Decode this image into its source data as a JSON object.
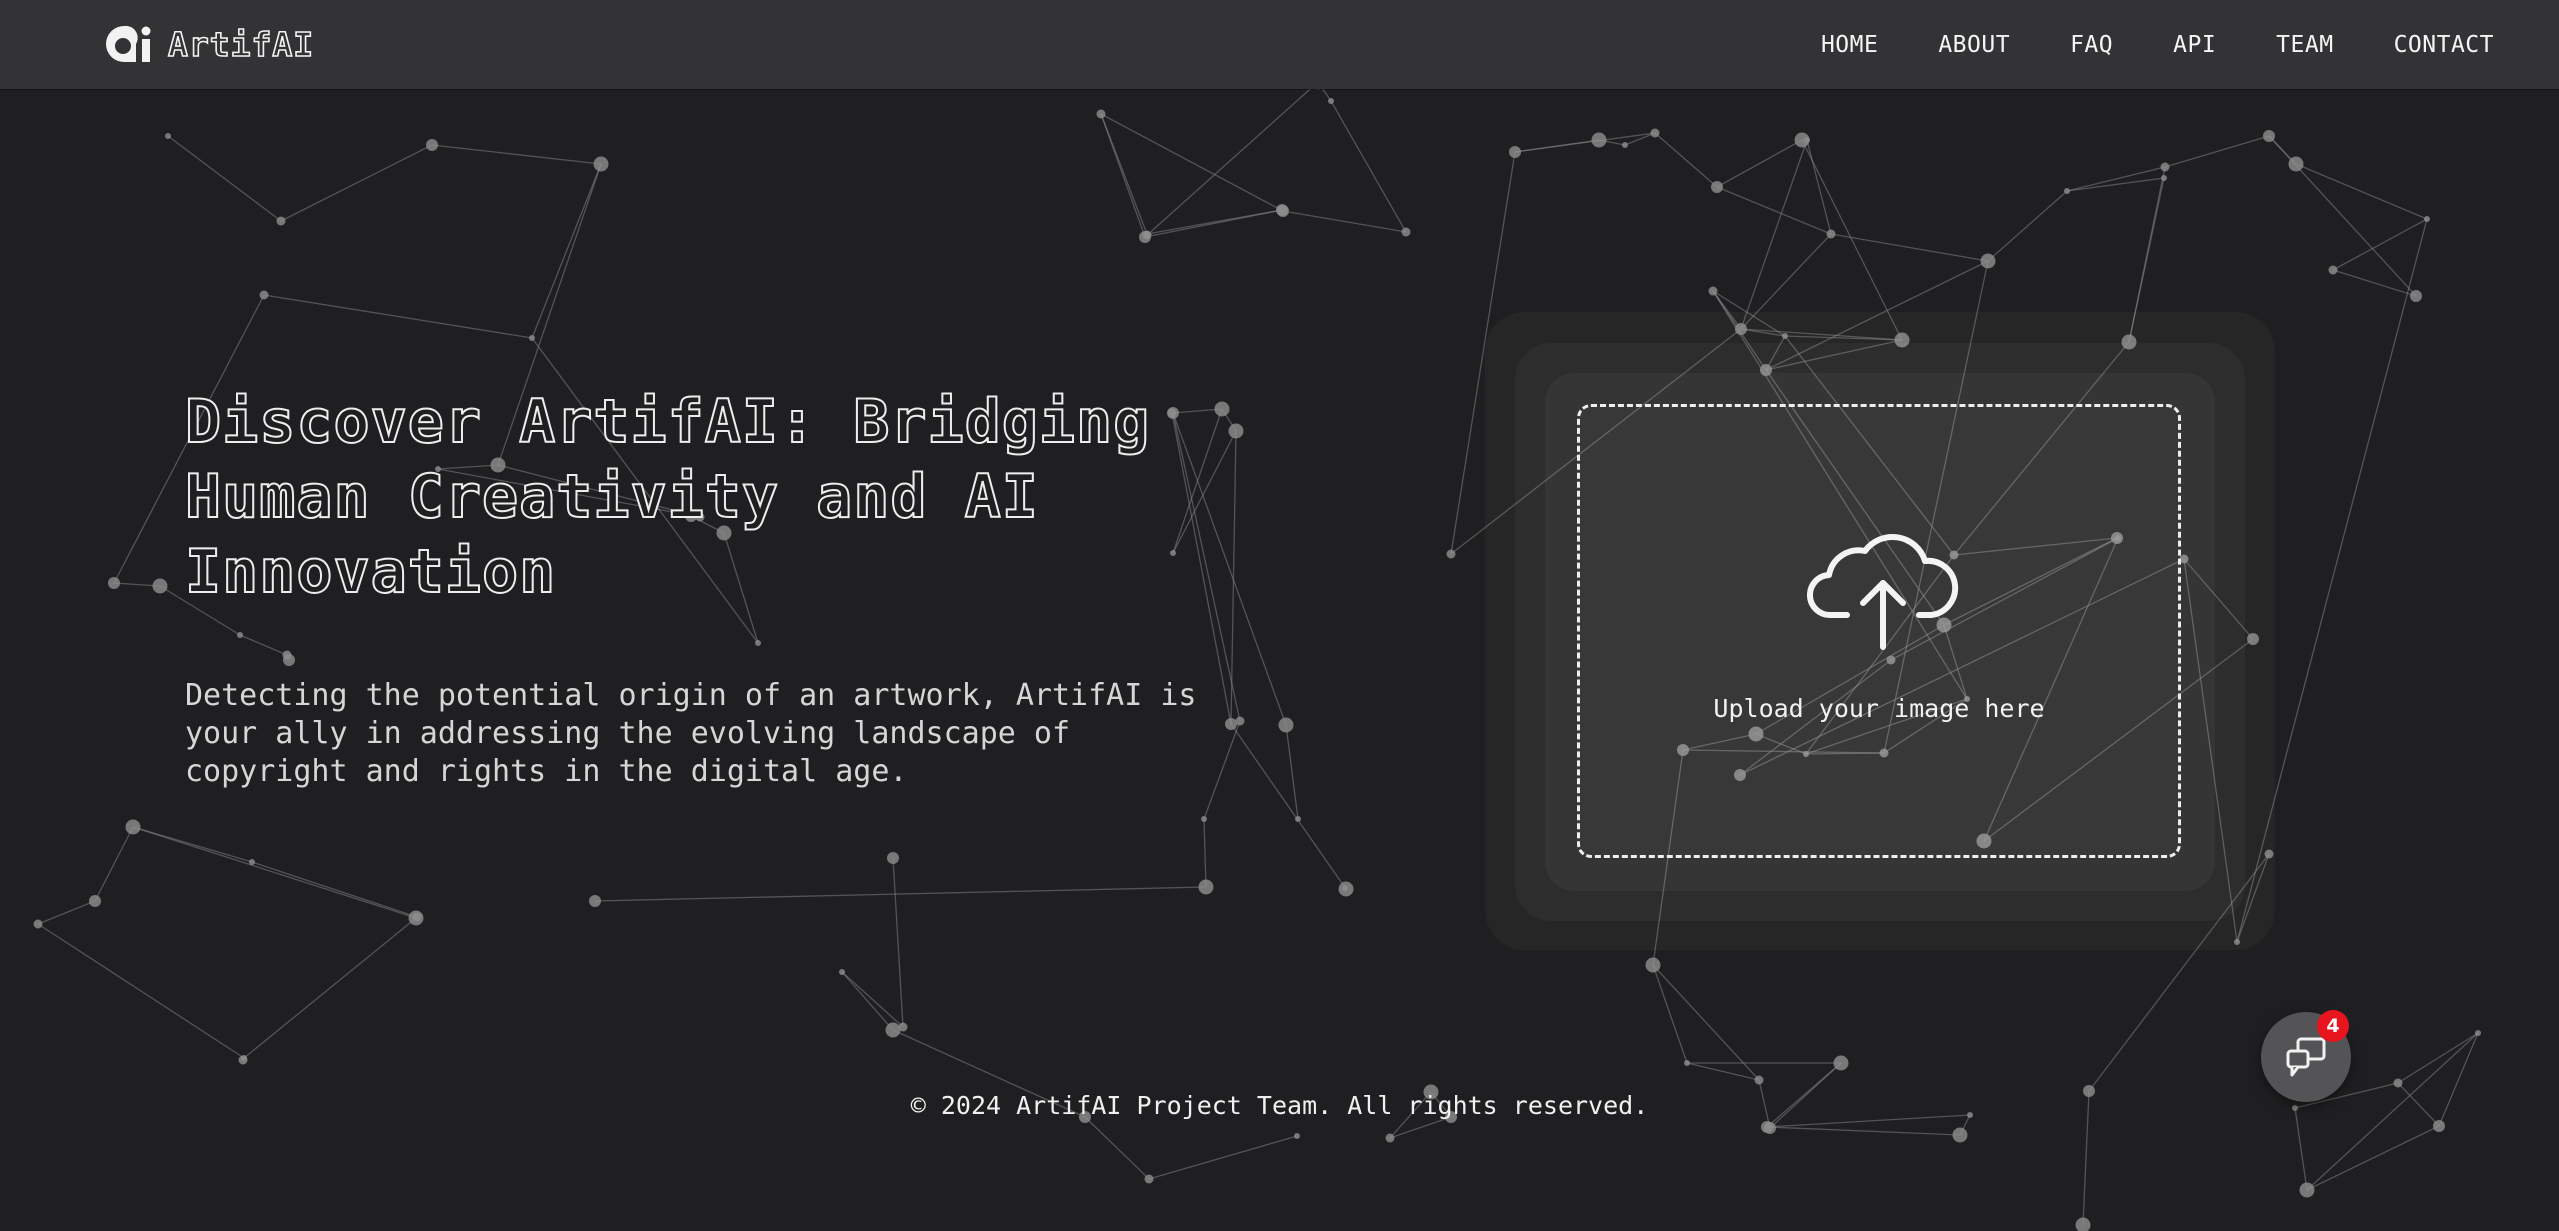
{
  "header": {
    "brand_name": "ArtifAI",
    "nav": [
      "HOME",
      "ABOUT",
      "FAQ",
      "API",
      "TEAM",
      "CONTACT"
    ]
  },
  "hero": {
    "title": "Discover ArtifAI: Bridging Human Creativity and AI Innovation",
    "description": "Detecting the potential origin of an artwork, ArtifAI is your ally in addressing the evolving landscape of copyright and rights in the digital age."
  },
  "upload": {
    "label": "Upload your image here",
    "icon": "cloud-upload-icon"
  },
  "footer": {
    "copyright": "© 2024 ArtifAI Project Team. All rights reserved."
  },
  "chat": {
    "icon": "chat-icon",
    "badge_count": "4",
    "badge_color": "#e8141e"
  },
  "colors": {
    "background": "#1f1f21",
    "header": "#333335",
    "text": "#f2f2f2"
  }
}
